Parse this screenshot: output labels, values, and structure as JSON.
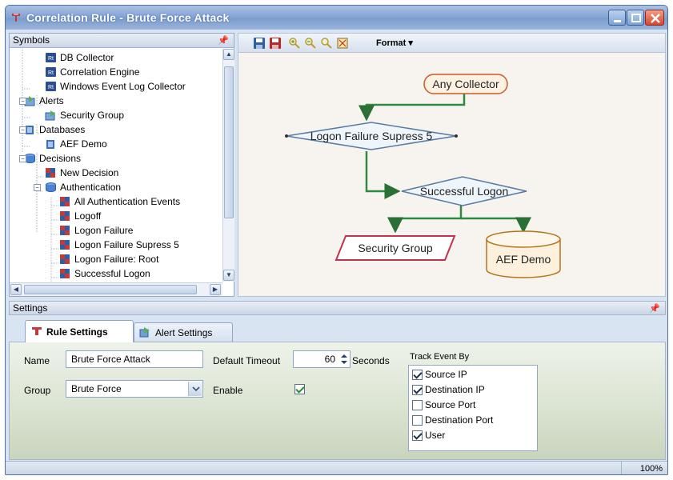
{
  "window": {
    "title": "Correlation Rule - Brute Force Attack"
  },
  "symbols": {
    "header": "Symbols",
    "tree": [
      {
        "label": "DB Collector",
        "icon": "collector-icon"
      },
      {
        "label": "Correlation Engine",
        "icon": "collector-icon"
      },
      {
        "label": "Windows Event Log Collector",
        "icon": "collector-icon"
      },
      {
        "label": "Alerts",
        "icon": "alerts-folder-icon",
        "expanded": true
      },
      {
        "label": "Security Group",
        "icon": "alert-icon"
      },
      {
        "label": "Databases",
        "icon": "database-folder-icon",
        "expanded": true
      },
      {
        "label": "AEF Demo",
        "icon": "database-icon"
      },
      {
        "label": "Decisions",
        "icon": "decisions-folder-icon",
        "expanded": true
      },
      {
        "label": "New Decision",
        "icon": "decision-icon"
      },
      {
        "label": "Authentication",
        "icon": "decisions-folder-icon",
        "expanded": true
      },
      {
        "label": "All Authentication Events",
        "icon": "decision-icon"
      },
      {
        "label": "Logoff",
        "icon": "decision-icon"
      },
      {
        "label": "Logon Failure",
        "icon": "decision-icon"
      },
      {
        "label": "Logon Failure Supress 5",
        "icon": "decision-icon"
      },
      {
        "label": "Logon Failure: Root",
        "icon": "decision-icon"
      },
      {
        "label": "Successful Logon",
        "icon": "decision-icon"
      }
    ]
  },
  "toolbar": {
    "format_label": "Format"
  },
  "flow": {
    "nodes": {
      "any_collector": "Any Collector",
      "logon_failure_supress": "Logon Failure Supress 5",
      "successful_logon": "Successful Logon",
      "security_group": "Security Group",
      "aef_demo": "AEF Demo"
    }
  },
  "settings": {
    "header": "Settings",
    "tabs": [
      "Rule Settings",
      "Alert Settings"
    ],
    "active_tab": "Rule Settings",
    "name_label": "Name",
    "name_value": "Brute Force Attack",
    "group_label": "Group",
    "group_value": "Brute Force",
    "timeout_label": "Default Timeout",
    "timeout_value": "60",
    "timeout_unit": "Seconds",
    "enable_label": "Enable",
    "enable_checked": true,
    "track_label": "Track Event By",
    "track_items": [
      {
        "label": "Source IP",
        "checked": true
      },
      {
        "label": "Destination IP",
        "checked": true
      },
      {
        "label": "Source Port",
        "checked": false
      },
      {
        "label": "Destination Port",
        "checked": false
      },
      {
        "label": "User",
        "checked": true
      }
    ]
  },
  "status": {
    "zoom": "100%"
  },
  "colors": {
    "flow_line": "#2e8b3e",
    "title_bar": "#86a6d4",
    "close_button": "#d8452c"
  }
}
